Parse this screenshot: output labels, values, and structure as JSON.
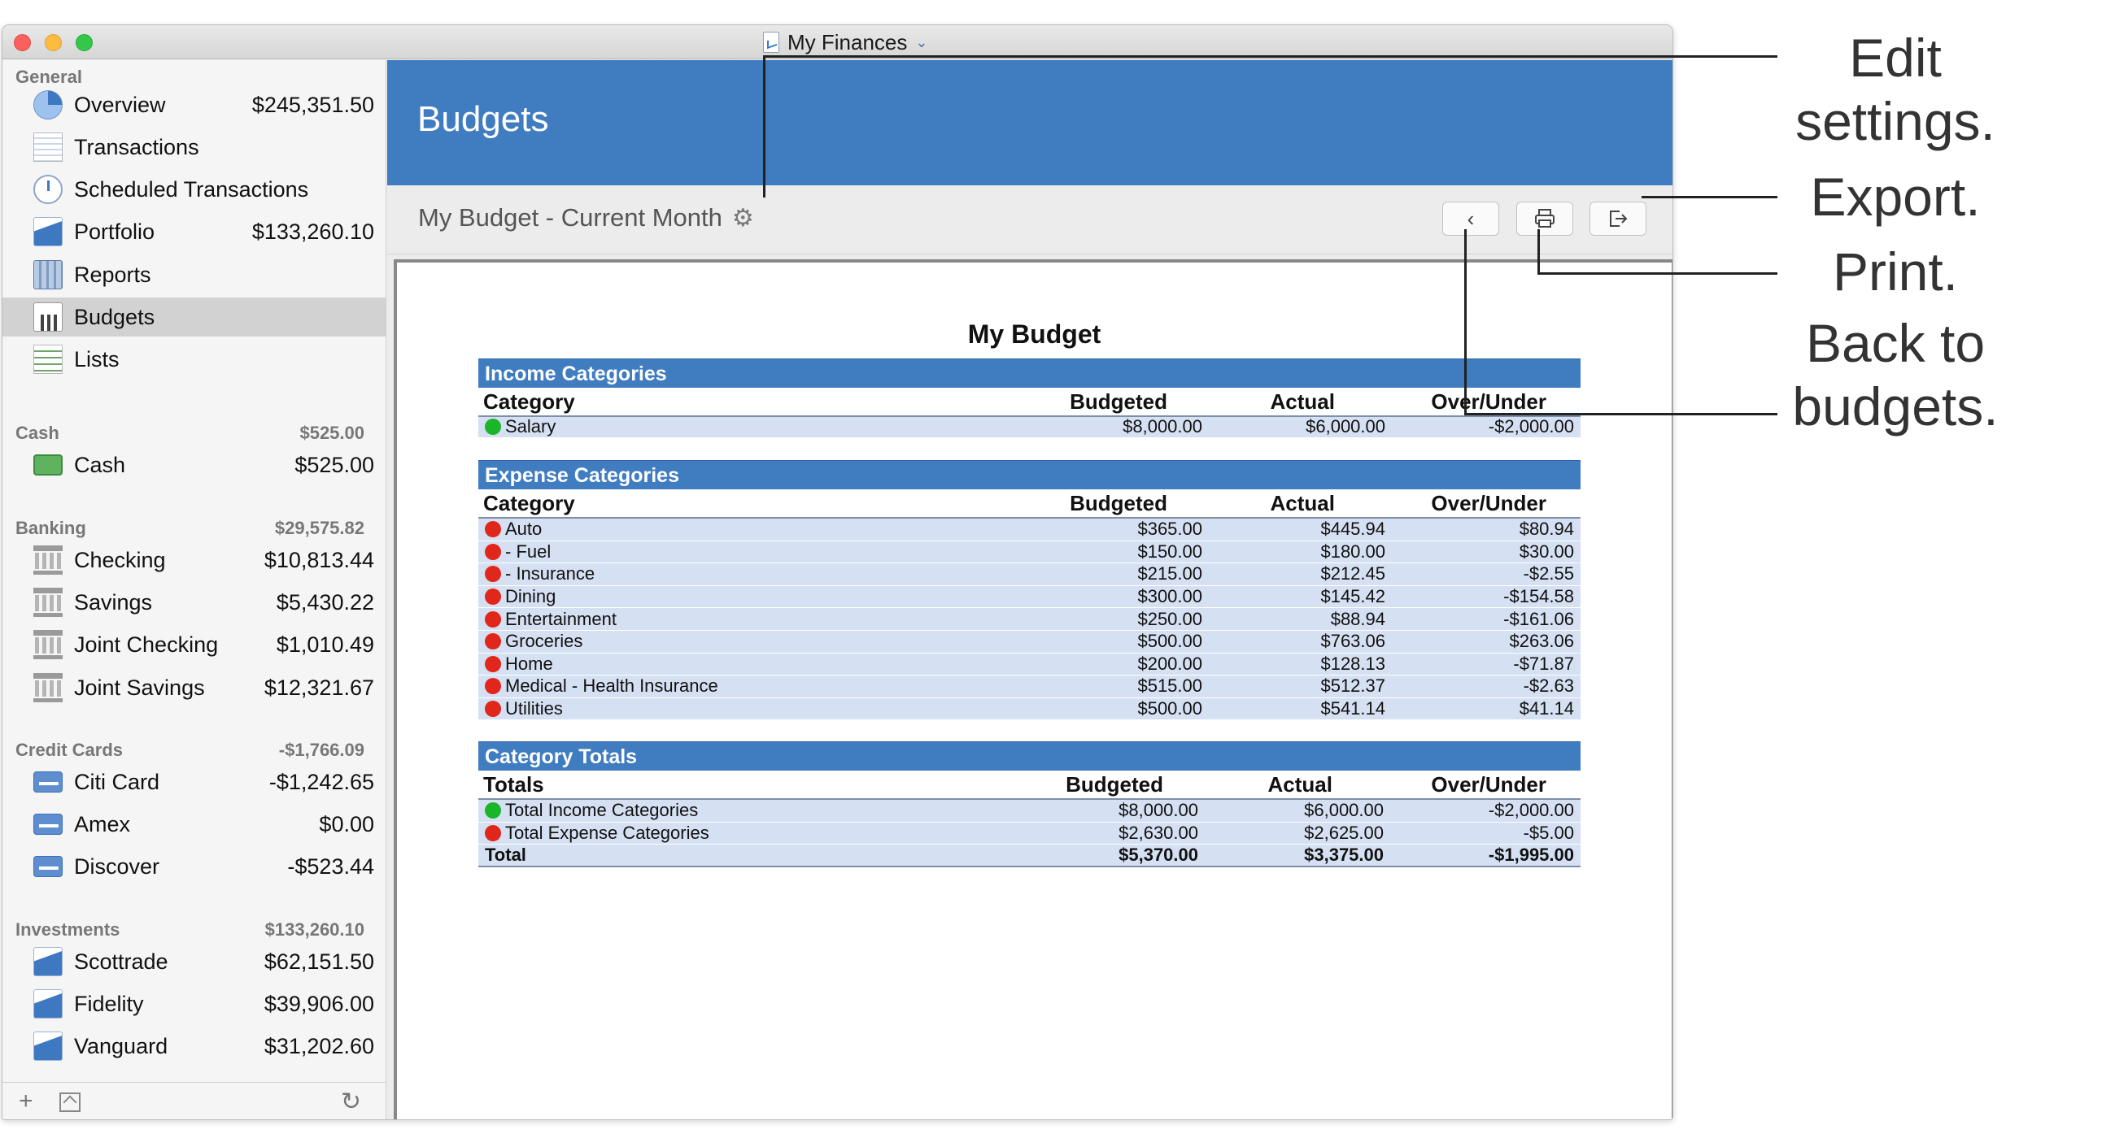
{
  "window": {
    "title": "My Finances"
  },
  "sidebar": {
    "sections": [
      {
        "label": "General",
        "total": ""
      },
      {
        "label": "Cash",
        "total": "$525.00"
      },
      {
        "label": "Banking",
        "total": "$29,575.82"
      },
      {
        "label": "Credit Cards",
        "total": "-$1,766.09"
      },
      {
        "label": "Investments",
        "total": "$133,260.10"
      }
    ],
    "items": [
      {
        "label": "Overview",
        "amount": "$245,351.50",
        "icon": "pie-chart-icon"
      },
      {
        "label": "Transactions",
        "amount": "",
        "icon": "ledger-icon"
      },
      {
        "label": "Scheduled Transactions",
        "amount": "",
        "icon": "clock-icon"
      },
      {
        "label": "Portfolio",
        "amount": "$133,260.10",
        "icon": "line-chart-icon"
      },
      {
        "label": "Reports",
        "amount": "",
        "icon": "report-icon"
      },
      {
        "label": "Budgets",
        "amount": "",
        "icon": "bar-chart-icon"
      },
      {
        "label": "Lists",
        "amount": "",
        "icon": "list-icon"
      },
      {
        "label": "Cash",
        "amount": "$525.00",
        "icon": "cash-icon"
      },
      {
        "label": "Checking",
        "amount": "$10,813.44",
        "icon": "bank-icon"
      },
      {
        "label": "Savings",
        "amount": "$5,430.22",
        "icon": "bank-icon"
      },
      {
        "label": "Joint Checking",
        "amount": "$1,010.49",
        "icon": "bank-icon"
      },
      {
        "label": "Joint Savings",
        "amount": "$12,321.67",
        "icon": "bank-icon"
      },
      {
        "label": "Citi Card",
        "amount": "-$1,242.65",
        "icon": "credit-card-icon"
      },
      {
        "label": "Amex",
        "amount": "$0.00",
        "icon": "credit-card-icon"
      },
      {
        "label": "Discover",
        "amount": "-$523.44",
        "icon": "credit-card-icon"
      },
      {
        "label": "Scottrade",
        "amount": "$62,151.50",
        "icon": "line-chart-icon"
      },
      {
        "label": "Fidelity",
        "amount": "$39,906.00",
        "icon": "line-chart-icon"
      },
      {
        "label": "Vanguard",
        "amount": "$31,202.60",
        "icon": "line-chart-icon"
      }
    ],
    "selected": "Budgets"
  },
  "header": {
    "title": "Budgets"
  },
  "toolbar": {
    "budget_name": "My Budget - Current Month"
  },
  "report": {
    "title": "My Budget",
    "columns": {
      "category": "Category",
      "totals": "Totals",
      "budgeted": "Budgeted",
      "actual": "Actual",
      "over_under": "Over/Under"
    },
    "income": {
      "heading": "Income Categories",
      "rows": [
        {
          "name": "Salary",
          "budgeted": "$8,000.00",
          "actual": "$6,000.00",
          "over_under": "-$2,000.00",
          "status": "green"
        }
      ]
    },
    "expense": {
      "heading": "Expense Categories",
      "rows": [
        {
          "name": "Auto",
          "budgeted": "$365.00",
          "actual": "$445.94",
          "over_under": "$80.94",
          "status": "red"
        },
        {
          "name": "- Fuel",
          "budgeted": "$150.00",
          "actual": "$180.00",
          "over_under": "$30.00",
          "status": "red"
        },
        {
          "name": "- Insurance",
          "budgeted": "$215.00",
          "actual": "$212.45",
          "over_under": "-$2.55",
          "status": "red"
        },
        {
          "name": "Dining",
          "budgeted": "$300.00",
          "actual": "$145.42",
          "over_under": "-$154.58",
          "status": "red"
        },
        {
          "name": "Entertainment",
          "budgeted": "$250.00",
          "actual": "$88.94",
          "over_under": "-$161.06",
          "status": "red"
        },
        {
          "name": "Groceries",
          "budgeted": "$500.00",
          "actual": "$763.06",
          "over_under": "$263.06",
          "status": "red"
        },
        {
          "name": "Home",
          "budgeted": "$200.00",
          "actual": "$128.13",
          "over_under": "-$71.87",
          "status": "red"
        },
        {
          "name": "Medical - Health Insurance",
          "budgeted": "$515.00",
          "actual": "$512.37",
          "over_under": "-$2.63",
          "status": "red"
        },
        {
          "name": "Utilities",
          "budgeted": "$500.00",
          "actual": "$541.14",
          "over_under": "$41.14",
          "status": "red"
        }
      ]
    },
    "totals": {
      "heading": "Category Totals",
      "rows": [
        {
          "name": "Total Income Categories",
          "budgeted": "$8,000.00",
          "actual": "$6,000.00",
          "over_under": "-$2,000.00",
          "status": "green"
        },
        {
          "name": "Total Expense Categories",
          "budgeted": "$2,630.00",
          "actual": "$2,625.00",
          "over_under": "-$5.00",
          "status": "red"
        }
      ],
      "grand": {
        "name": "Total",
        "budgeted": "$5,370.00",
        "actual": "$3,375.00",
        "over_under": "-$1,995.00"
      }
    }
  },
  "callouts": {
    "edit_1": "Edit",
    "edit_2": "settings.",
    "export": "Export.",
    "print": "Print.",
    "back_1": "Back to",
    "back_2": "budgets."
  },
  "colors": {
    "header_blue": "#3f7cc0",
    "row_blue": "#d5e0f2",
    "green": "#1bb52a",
    "red": "#e1261c"
  }
}
